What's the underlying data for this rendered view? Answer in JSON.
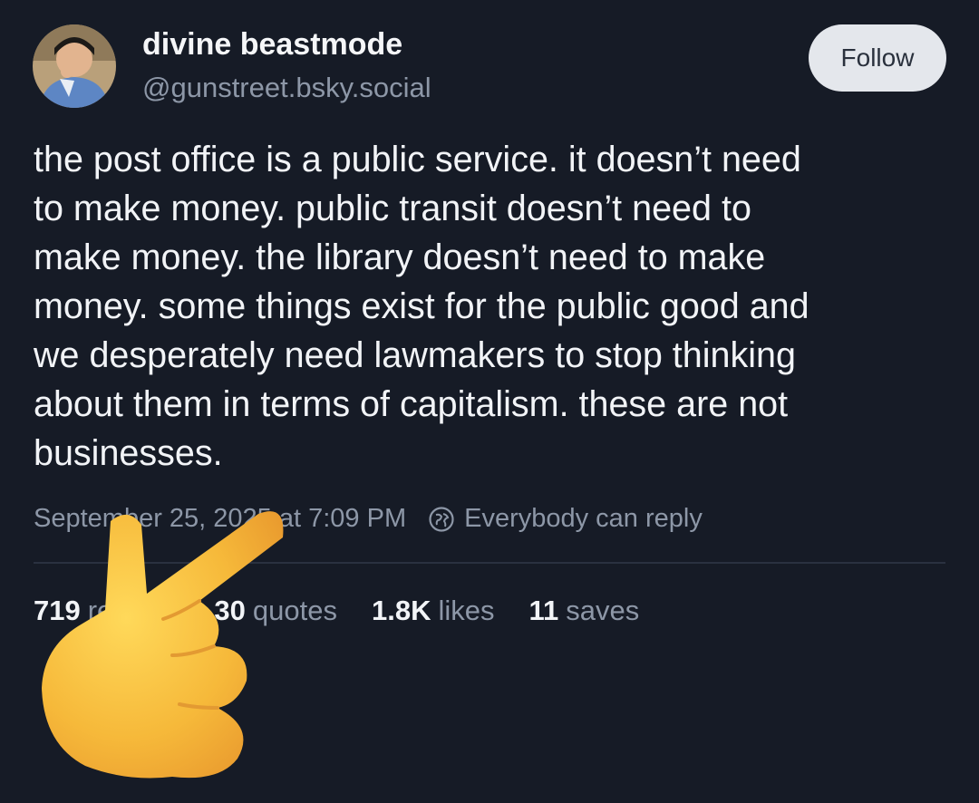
{
  "author": {
    "display_name": "divine beastmode",
    "handle": "@gunstreet.bsky.social",
    "avatar_icon": "avatar-image"
  },
  "follow_button": {
    "label": "Follow"
  },
  "post": {
    "text": "the post office is a public service. it doesn’t need\nto make money. public transit doesn’t need to\nmake money. the library doesn’t need to make\nmoney. some things exist for the public good and\nwe desperately need lawmakers to stop thinking\nabout them in terms of capitalism. these are not\nbusinesses."
  },
  "meta": {
    "timestamp": "September 25, 2025 at 7:09 PM",
    "reply_setting": "Everybody can reply",
    "reply_icon": "globe-icon"
  },
  "stats": [
    {
      "count": "719",
      "label": "reposts"
    },
    {
      "count": "30",
      "label": "quotes"
    },
    {
      "count": "1.8K",
      "label": "likes"
    },
    {
      "count": "11",
      "label": "saves"
    }
  ],
  "overlay": {
    "icon": "pointing-hand-emoji"
  },
  "colors": {
    "background": "#161b26",
    "text": "#f2f4f7",
    "muted": "#8d97a7",
    "button_bg": "#e4e7ec",
    "emoji_yellow": "#f8c23c"
  }
}
